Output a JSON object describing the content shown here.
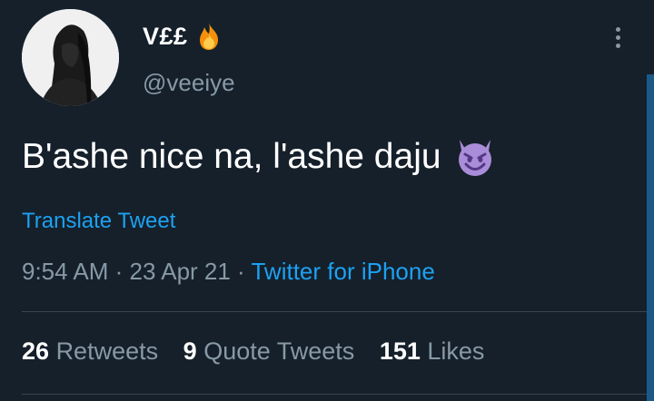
{
  "author": {
    "display_name": "V££",
    "emoji": "fire-emoji",
    "handle": "@veeiye"
  },
  "tweet": {
    "text": "B'ashe nice na, l'ashe daju",
    "emoji": "smiling-face-with-horns-emoji",
    "translate_label": "Translate Tweet",
    "time": "9:54 AM",
    "separator": " · ",
    "date": "23 Apr 21",
    "source": "Twitter for iPhone"
  },
  "stats": {
    "retweets_count": "26",
    "retweets_label": "Retweets",
    "quote_count": "9",
    "quote_label": "Quote Tweets",
    "likes_count": "151",
    "likes_label": "Likes"
  },
  "colors": {
    "background": "#15202b",
    "link": "#1da1f2",
    "muted": "#8899a6"
  }
}
